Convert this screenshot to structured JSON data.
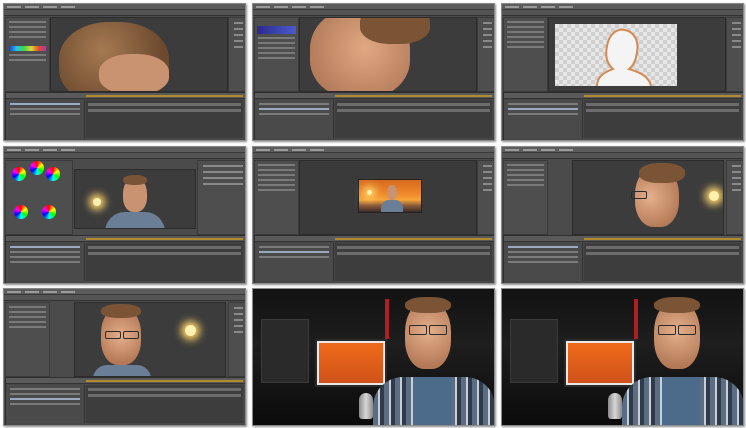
{
  "sheet": {
    "thumbnails": [
      {
        "kind": "after-effects",
        "scene": "close-up-hair-on-transparency"
      },
      {
        "kind": "after-effects",
        "scene": "close-up-face-on-sunset"
      },
      {
        "kind": "after-effects",
        "scene": "matte-outline-silhouette"
      },
      {
        "kind": "after-effects",
        "scene": "color-wheels-and-sunset-composite"
      },
      {
        "kind": "after-effects",
        "scene": "small-composite-preview"
      },
      {
        "kind": "after-effects",
        "scene": "profile-on-sunset"
      },
      {
        "kind": "after-effects",
        "scene": "front-face-on-sunset"
      },
      {
        "kind": "presenter",
        "scene": "presenter-studio"
      },
      {
        "kind": "presenter",
        "scene": "presenter-studio"
      }
    ]
  },
  "colors": {
    "accent_orange": "#f08a2a",
    "panel_gray": "#4b4b4b",
    "timeline_marker": "#b08a2c"
  }
}
